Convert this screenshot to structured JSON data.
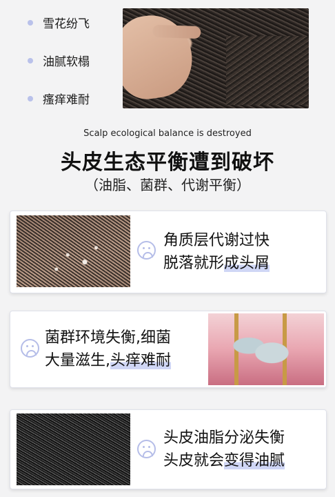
{
  "symptoms": [
    "雪花纷飞",
    "油腻软榻",
    "瘙痒难耐"
  ],
  "subtitle_en": "Scalp ecological balance is destroyed",
  "title": "头皮生态平衡遭到破坏",
  "title_paren": "（油脂、菌群、代谢平衡）",
  "cards": [
    {
      "line1": "角质层代谢过快",
      "line2_plain": "脱落就形",
      "line2_highlight": "成头屑"
    },
    {
      "line1": "菌群环境失衡,细菌",
      "line2_plain": "大量滋生,",
      "line2_highlight": "头痒难耐"
    },
    {
      "line1": "头皮油脂分泌失衡",
      "line2_plain": "头皮就会",
      "line2_highlight": "变得油腻"
    }
  ],
  "colors": {
    "accent": "#b9c1ea",
    "highlight": "#cfd6f5",
    "background": "#f3f3f4"
  },
  "icons": [
    "bullet-dot",
    "sad-face-icon"
  ]
}
